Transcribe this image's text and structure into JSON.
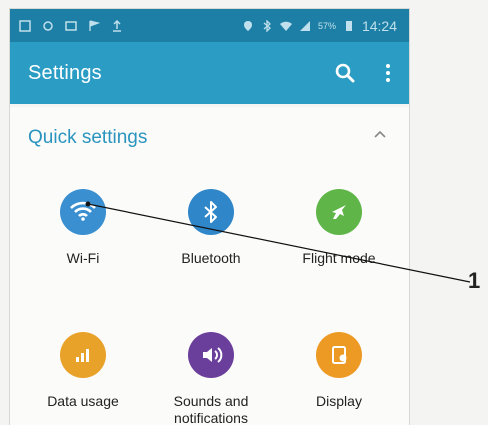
{
  "statusbar": {
    "time": "14:24",
    "battery": "57%"
  },
  "appbar": {
    "title": "Settings"
  },
  "quick_settings": {
    "title": "Quick settings",
    "tiles": [
      {
        "label": "Wi-Fi",
        "color": "#3a8fd0",
        "icon": "wifi-icon"
      },
      {
        "label": "Bluetooth",
        "color": "#2f86c8",
        "icon": "bluetooth-icon"
      },
      {
        "label": "Flight mode",
        "color": "#5fb548",
        "icon": "airplane-icon"
      },
      {
        "label": "Data usage",
        "color": "#e9a229",
        "icon": "data-usage-icon"
      },
      {
        "label": "Sounds and notifications",
        "color": "#6a3f9c",
        "icon": "speaker-icon"
      },
      {
        "label": "Display",
        "color": "#ec9a24",
        "icon": "display-icon"
      }
    ]
  },
  "callout": {
    "number": "1"
  }
}
